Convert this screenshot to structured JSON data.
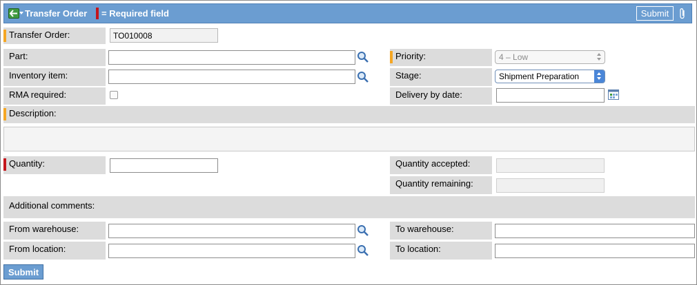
{
  "header": {
    "title": "Transfer Order",
    "required_legend": "= Required field",
    "submit_label": "Submit"
  },
  "fields": {
    "transfer_order": {
      "label": "Transfer Order:",
      "value": "TO010008"
    },
    "part": {
      "label": "Part:",
      "value": ""
    },
    "inventory_item": {
      "label": "Inventory item:",
      "value": ""
    },
    "rma_required": {
      "label": "RMA required:",
      "checked": false
    },
    "priority": {
      "label": "Priority:",
      "value": "4 – Low"
    },
    "stage": {
      "label": "Stage:",
      "value": "Shipment Preparation"
    },
    "delivery_by_date": {
      "label": "Delivery by date:",
      "value": ""
    },
    "description": {
      "label": "Description:",
      "value": ""
    },
    "quantity": {
      "label": "Quantity:",
      "value": ""
    },
    "quantity_accepted": {
      "label": "Quantity accepted:",
      "value": ""
    },
    "quantity_remaining": {
      "label": "Quantity remaining:",
      "value": ""
    },
    "additional_comments": {
      "label": "Additional comments:"
    },
    "from_warehouse": {
      "label": "From warehouse:",
      "value": ""
    },
    "to_warehouse": {
      "label": "To warehouse:",
      "value": ""
    },
    "from_location": {
      "label": "From location:",
      "value": ""
    },
    "to_location": {
      "label": "To location:",
      "value": ""
    }
  },
  "footer": {
    "submit_label": "Submit"
  },
  "colors": {
    "header_bg": "#6b9dd1",
    "label_bg": "#dcdcdc",
    "required_marker": "#c4161c",
    "recommended_marker": "#f5a623",
    "back_button": "#3f9a3f"
  },
  "icons": [
    "back-arrow-icon",
    "paperclip-icon",
    "magnifier-icon",
    "calendar-icon"
  ]
}
